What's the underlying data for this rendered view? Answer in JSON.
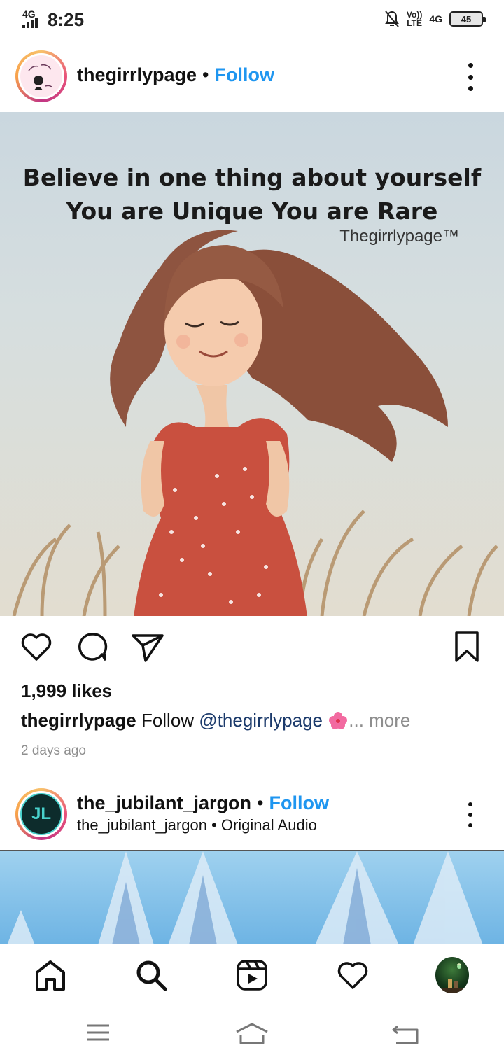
{
  "status_bar": {
    "network_type": "4G",
    "time": "8:25",
    "volte_top": "Vo))",
    "volte_bottom": "LTE",
    "network_right": "4G",
    "battery_level": "45"
  },
  "post": {
    "username": "thegirrlypage",
    "separator": "•",
    "follow_label": "Follow",
    "image_quote_line1": "Believe in one thing about yourself",
    "image_quote_line2": "You are Unique You are Rare",
    "image_brand": "Thegirrlypage™",
    "likes": "1,999 likes",
    "caption_user": "thegirrlypage",
    "caption_text": " Follow ",
    "caption_mention": "@thegirrlypage",
    "caption_more": "... more",
    "time_ago": "2 days ago"
  },
  "post2": {
    "username": "the_jubilant_jargon",
    "separator": "•",
    "follow_label": "Follow",
    "subtitle": "the_jubilant_jargon • Original Audio",
    "avatar_initials": "JL"
  },
  "icons": {
    "like": "heart-icon",
    "comment": "comment-icon",
    "share": "send-icon",
    "save": "bookmark-icon",
    "home": "home-icon",
    "search": "search-icon",
    "reels": "reels-icon",
    "activity": "heart-icon",
    "menu": "menu-icon",
    "sys_home": "home-icon",
    "back": "back-icon"
  },
  "colors": {
    "follow_blue": "#1f96f0",
    "mention_blue": "#1b3a6b",
    "muted_gray": "#8e8e8e"
  }
}
